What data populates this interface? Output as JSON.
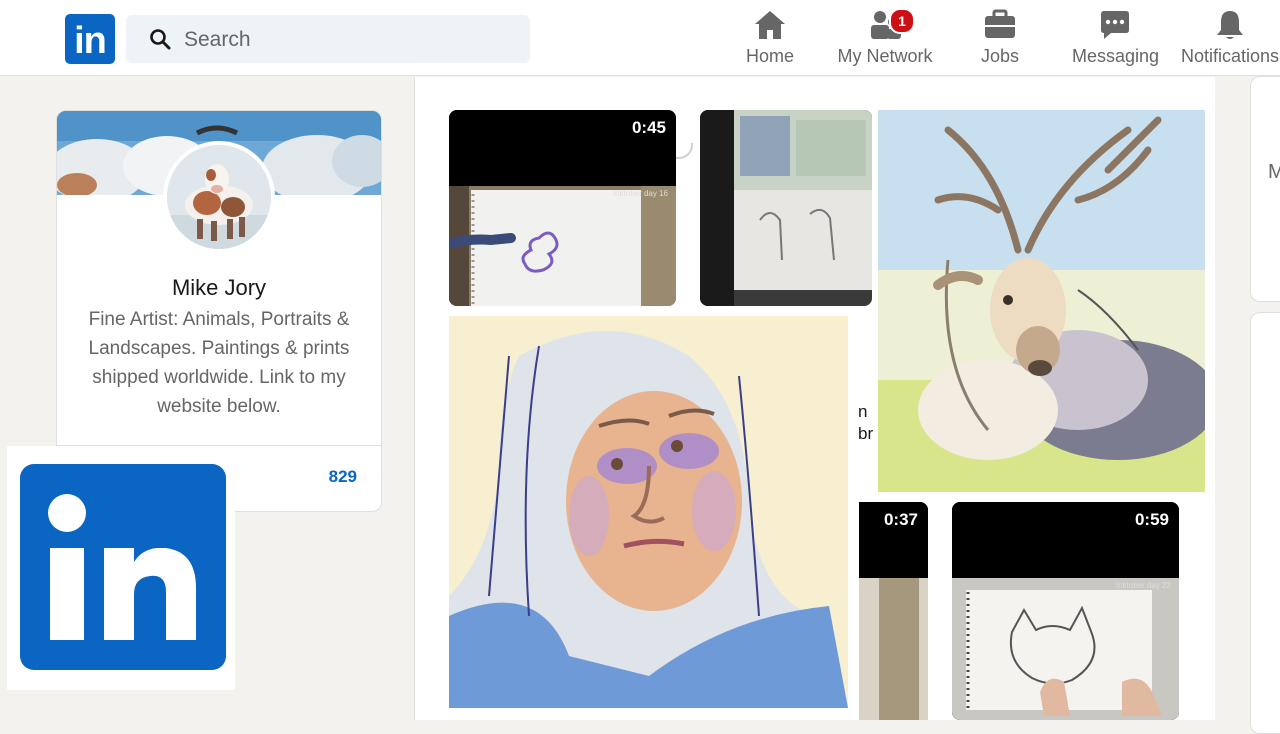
{
  "nav": {
    "search_placeholder": "Search",
    "items": [
      {
        "label": "Home",
        "icon": "home-icon"
      },
      {
        "label": "My Network",
        "icon": "people-icon",
        "badge": "1"
      },
      {
        "label": "Jobs",
        "icon": "briefcase-icon"
      },
      {
        "label": "Messaging",
        "icon": "chat-icon"
      },
      {
        "label": "Notifications",
        "icon": "bell-icon"
      }
    ]
  },
  "profile": {
    "name": "Mike Jory",
    "headline": "Fine Artist: Animals, Portraits & Landscapes. Paintings & prints shipped worldwide. Link to my website below.",
    "stat_value": "829"
  },
  "feed": {
    "tiles": [
      {
        "duration": "0:45"
      },
      {
        "duration": "0:37"
      },
      {
        "duration": "0:59"
      }
    ],
    "caption_lines": [
      "n",
      "br"
    ],
    "video_overlay_labels": [
      "Inktober day 16",
      "Inktober day 22"
    ]
  },
  "right_column": {
    "partial_letter": "M"
  },
  "colors": {
    "brand": "#0a66c2",
    "badge": "#cc1016",
    "page_bg": "#f3f2ef"
  }
}
